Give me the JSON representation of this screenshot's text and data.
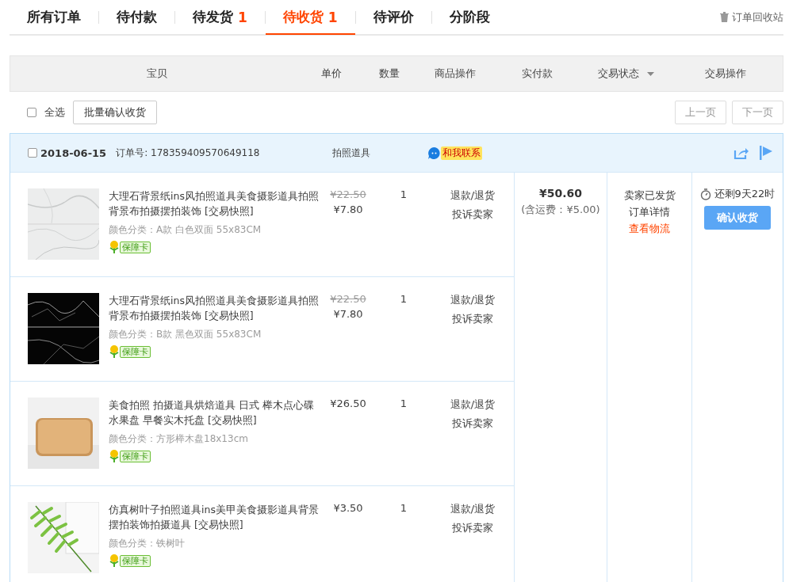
{
  "tabs": [
    {
      "label": "所有订单",
      "selected": false
    },
    {
      "label": "待付款",
      "selected": false
    },
    {
      "label": "待发货",
      "count": "1",
      "selected": false
    },
    {
      "label": "待收货",
      "count": "1",
      "selected": true
    },
    {
      "label": "待评价",
      "selected": false
    },
    {
      "label": "分阶段",
      "selected": false
    }
  ],
  "recycle_bin": "订单回收站",
  "columns": [
    {
      "label": "宝贝",
      "dropdown": false
    },
    {
      "label": "单价",
      "dropdown": false
    },
    {
      "label": "数量",
      "dropdown": false
    },
    {
      "label": "商品操作",
      "dropdown": false
    },
    {
      "label": "实付款",
      "dropdown": false
    },
    {
      "label": "交易状态",
      "dropdown": true
    },
    {
      "label": "交易操作",
      "dropdown": false
    }
  ],
  "toolbar": {
    "select_all": {
      "label": "全选",
      "checked": false
    },
    "batch_button": "批量确认收货",
    "pager": [
      {
        "label": "上一页",
        "disabled": true
      },
      {
        "label": "下一页",
        "disabled": true
      }
    ]
  },
  "order": {
    "checked": false,
    "date": "2018-06-15",
    "order_no": "订单号: 178359409570649118",
    "shop": "拍照道具",
    "contact": "和我联系",
    "items": [
      {
        "title": "大理石背景纸ins风拍照道具美食摄影道具拍照背景布拍摄摆拍装饰 [交易快照]",
        "original_price": "¥22.50",
        "price": "¥7.80",
        "qty": "1",
        "spec": "颜色分类：A款 白色双面 55x83CM",
        "guarantee": "保障卡",
        "ops": [
          "退款/退货",
          "投诉卖家"
        ]
      },
      {
        "title": "大理石背景纸ins风拍照道具美食摄影道具拍照背景布拍摄摆拍装饰 [交易快照]",
        "original_price": "¥22.50",
        "price": "¥7.80",
        "qty": "1",
        "spec": "颜色分类：B款 黑色双面 55x83CM",
        "guarantee": "保障卡",
        "ops": [
          "退款/退货",
          "投诉卖家"
        ]
      },
      {
        "title": "美食拍照 拍摄道具烘焙道具 日式 榉木点心碟水果盘 早餐实木托盘 [交易快照]",
        "price": "¥26.50",
        "qty": "1",
        "spec": "颜色分类：方形榉木盘18x13cm",
        "guarantee": "保障卡",
        "ops": [
          "退款/退货",
          "投诉卖家"
        ]
      },
      {
        "title": "仿真树叶子拍照道具ins美甲美食摄影道具背景摆拍装饰拍摄道具 [交易快照]",
        "price": "¥3.50",
        "qty": "1",
        "spec": "颜色分类：铁树叶",
        "guarantee": "保障卡",
        "ops": [
          "退款/退货",
          "投诉卖家"
        ]
      }
    ],
    "payment": {
      "total": "¥50.60",
      "shipping": "(含运费：¥5.00)"
    },
    "status": [
      {
        "text": "卖家已发货",
        "kind": "text"
      },
      {
        "text": "订单详情",
        "kind": "link"
      },
      {
        "text": "查看物流",
        "kind": "alert-link"
      }
    ],
    "countdown": "还剩9天22时",
    "confirm_button": "确认收货"
  }
}
